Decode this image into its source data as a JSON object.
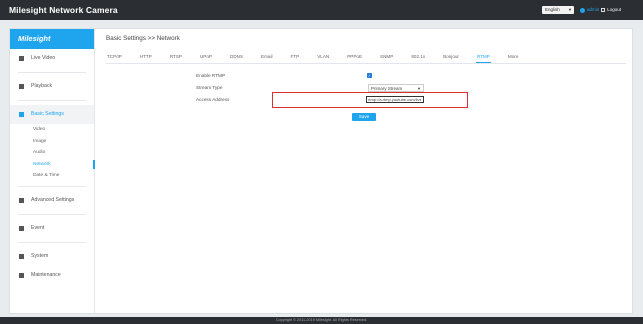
{
  "header": {
    "app_title": "Milesight Network Camera",
    "language": "English",
    "user": "admin",
    "logout": "Logout"
  },
  "sidebar": {
    "logo": "Milesight",
    "items": [
      {
        "label": "Live Video",
        "icon": "video-icon"
      },
      {
        "label": "Playback",
        "icon": "playback-icon"
      },
      {
        "label": "Basic Settings",
        "icon": "settings-icon"
      },
      {
        "label": "Advanced Settings",
        "icon": "advanced-settings-icon"
      },
      {
        "label": "Event",
        "icon": "event-icon"
      },
      {
        "label": "System",
        "icon": "system-icon"
      },
      {
        "label": "Maintenance",
        "icon": "maintenance-icon"
      }
    ],
    "subitems": [
      "Video",
      "Image",
      "Audio",
      "Network",
      "Date & Time"
    ]
  },
  "breadcrumb": "Basic Settings >> Network",
  "tabs": [
    "TCP/IP",
    "HTTP",
    "RTSP",
    "UPnP",
    "DDNS",
    "Email",
    "FTP",
    "VLAN",
    "PPPoE",
    "SNMP",
    "802.1x",
    "Bonjour",
    "RTMP",
    "More"
  ],
  "form": {
    "enable_label": "Enable RTMP",
    "enable_checked": true,
    "stream_label": "Stream Type",
    "stream_value": "Primary Stream",
    "address_label": "Access Address",
    "address_value": "rtmp://a.rtmp.youtube.com/live2"
  },
  "save_label": "Save",
  "footer": "Copyright © 2011-2019 Milesight. All Rights Reserved.",
  "colors": {
    "accent": "#1fa4ee",
    "topbar": "#2b2f33",
    "highlight": "#d6312e"
  }
}
